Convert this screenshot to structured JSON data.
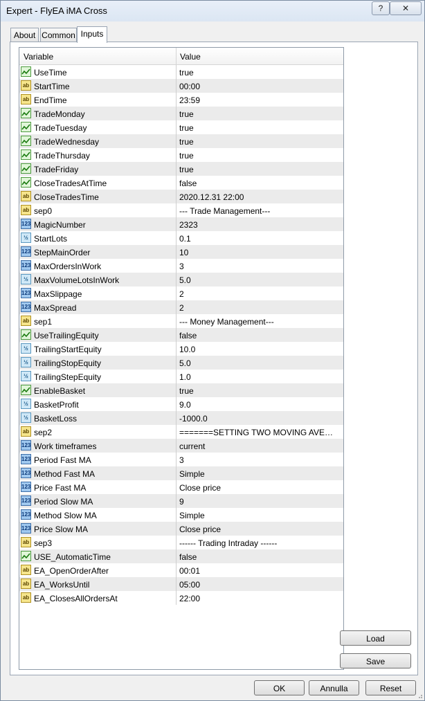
{
  "window": {
    "title": "Expert - FlyEA iMA Cross",
    "help_label": "?",
    "close_label": "✕"
  },
  "tabs": [
    {
      "label": "About"
    },
    {
      "label": "Common"
    },
    {
      "label": "Inputs"
    }
  ],
  "columns": {
    "variable": "Variable",
    "value": "Value"
  },
  "params": [
    {
      "type": "bool",
      "name": "UseTime",
      "value": "true"
    },
    {
      "type": "str",
      "name": "StartTime",
      "value": "00:00"
    },
    {
      "type": "str",
      "name": "EndTime",
      "value": "23:59"
    },
    {
      "type": "bool",
      "name": "TradeMonday",
      "value": "true"
    },
    {
      "type": "bool",
      "name": "TradeTuesday",
      "value": "true"
    },
    {
      "type": "bool",
      "name": "TradeWednesday",
      "value": "true"
    },
    {
      "type": "bool",
      "name": "TradeThursday",
      "value": "true"
    },
    {
      "type": "bool",
      "name": "TradeFriday",
      "value": "true"
    },
    {
      "type": "bool",
      "name": "CloseTradesAtTime",
      "value": "false"
    },
    {
      "type": "str",
      "name": "CloseTradesTime",
      "value": "2020.12.31  22:00"
    },
    {
      "type": "str",
      "name": "sep0",
      "value": "--- Trade Management---"
    },
    {
      "type": "int",
      "name": "MagicNumber",
      "value": "2323"
    },
    {
      "type": "dbl",
      "name": "StartLots",
      "value": "0.1"
    },
    {
      "type": "int",
      "name": "StepMainOrder",
      "value": "10"
    },
    {
      "type": "int",
      "name": "MaxOrdersInWork",
      "value": "3"
    },
    {
      "type": "dbl",
      "name": "MaxVolumeLotsInWork",
      "value": "5.0"
    },
    {
      "type": "int",
      "name": "MaxSlippage",
      "value": "2"
    },
    {
      "type": "int",
      "name": "MaxSpread",
      "value": "2"
    },
    {
      "type": "str",
      "name": "sep1",
      "value": "--- Money Management---"
    },
    {
      "type": "bool",
      "name": "UseTrailingEquity",
      "value": "false"
    },
    {
      "type": "dbl",
      "name": "TrailingStartEquity",
      "value": "10.0"
    },
    {
      "type": "dbl",
      "name": "TrailingStopEquity",
      "value": "5.0"
    },
    {
      "type": "dbl",
      "name": "TrailingStepEquity",
      "value": "1.0"
    },
    {
      "type": "bool",
      "name": "EnableBasket",
      "value": "true"
    },
    {
      "type": "dbl",
      "name": "BasketProfit",
      "value": "9.0"
    },
    {
      "type": "dbl",
      "name": "BasketLoss",
      "value": "-1000.0"
    },
    {
      "type": "str",
      "name": "sep2",
      "value": "=======SETTING TWO MOVING AVERAG..."
    },
    {
      "type": "int",
      "name": "Work timeframes",
      "value": "current"
    },
    {
      "type": "int",
      "name": "Period Fast MA",
      "value": "3"
    },
    {
      "type": "int",
      "name": "Method Fast MA",
      "value": "Simple"
    },
    {
      "type": "int",
      "name": "Price Fast MA",
      "value": "Close price"
    },
    {
      "type": "int",
      "name": "Period Slow MA",
      "value": "9"
    },
    {
      "type": "int",
      "name": "Method Slow MA",
      "value": "Simple"
    },
    {
      "type": "int",
      "name": "Price Slow MA",
      "value": "Close price"
    },
    {
      "type": "str",
      "name": "sep3",
      "value": "------ Trading Intraday ------"
    },
    {
      "type": "bool",
      "name": "USE_AutomaticTime",
      "value": "false"
    },
    {
      "type": "str",
      "name": "EA_OpenOrderAfter",
      "value": "00:01"
    },
    {
      "type": "str",
      "name": "EA_WorksUntil",
      "value": "05:00"
    },
    {
      "type": "str",
      "name": "EA_ClosesAllOrdersAt",
      "value": "22:00"
    }
  ],
  "icon_glyphs": {
    "bool": "",
    "str": "ab",
    "int": "123",
    "dbl": "½"
  },
  "buttons": {
    "load": "Load",
    "save": "Save",
    "ok": "OK",
    "cancel": "Annulla",
    "reset": "Reset"
  }
}
